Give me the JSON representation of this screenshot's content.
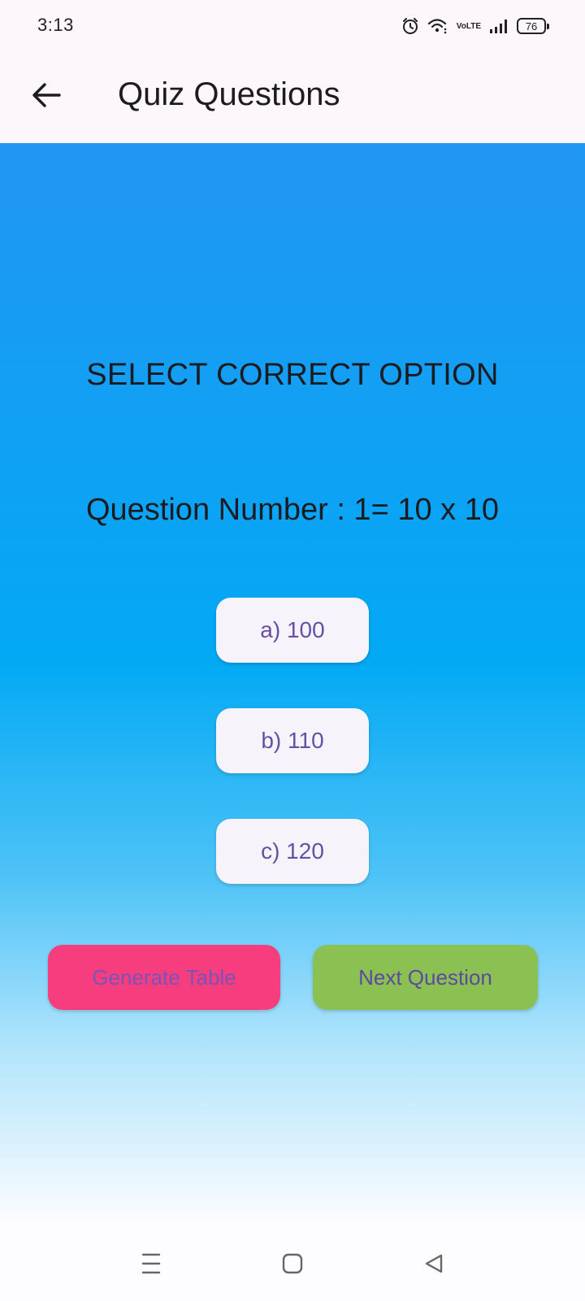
{
  "status_bar": {
    "time": "3:13",
    "volte_line1": "Vo",
    "volte_line2": "LTE",
    "battery": "76"
  },
  "app_bar": {
    "title": "Quiz Questions"
  },
  "quiz": {
    "instruction": "SELECT CORRECT OPTION",
    "question": "Question Number : 1= 10 x 10",
    "options": [
      {
        "label": "a) 100"
      },
      {
        "label": "b) 110"
      },
      {
        "label": "c) 120"
      }
    ],
    "generate_table_label": "Generate Table",
    "next_question_label": "Next Question"
  },
  "colors": {
    "gradient_top": "#2196f3",
    "gradient_mid": "#03a9f4",
    "generate_button": "#f63e7f",
    "next_button": "#8bc152",
    "option_text": "#6750a4"
  },
  "icons": {
    "back": "arrow-left-icon",
    "alarm": "alarm-icon",
    "wifi": "wifi-icon",
    "signal": "signal-icon",
    "battery": "battery-icon",
    "nav_menu": "recent-apps-icon",
    "nav_home": "home-icon",
    "nav_back": "triangle-back-icon"
  }
}
